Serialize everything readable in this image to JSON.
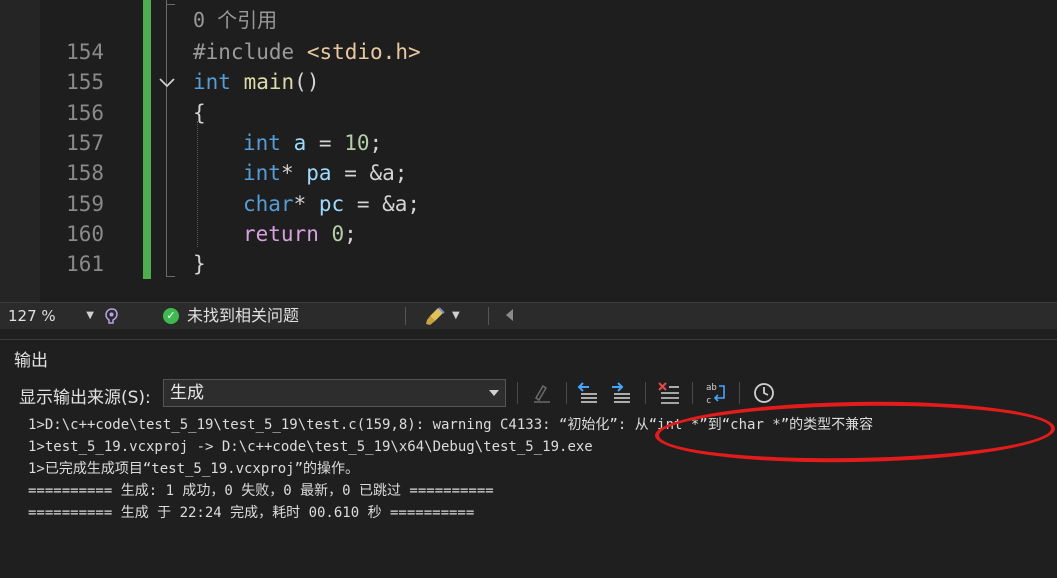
{
  "editor": {
    "codelens": "0 个引用",
    "lines": [
      {
        "num": "154"
      },
      {
        "num": "155"
      },
      {
        "num": "156"
      },
      {
        "num": "157"
      },
      {
        "num": "158"
      },
      {
        "num": "159"
      },
      {
        "num": "160"
      },
      {
        "num": "161"
      }
    ],
    "tokens": {
      "include_kw": "#include",
      "include_hdr": "<stdio.h>",
      "int": "int",
      "main": "main",
      "parens": "()",
      "brace_open": "{",
      "brace_close": "}",
      "a": "a",
      "eq": " = ",
      "ten": "10",
      "semi": ";",
      "int_ptr": "int",
      "star": "*",
      "pa": "pa",
      "amp_a": "&a",
      "char": "char",
      "pc": "pc",
      "return": "return",
      "zero": "0"
    }
  },
  "statusbar": {
    "zoom": "127 %",
    "issues": "未找到相关问题"
  },
  "output": {
    "title": "输出",
    "source_label": "显示输出来源(S):",
    "source_value": "生成",
    "lines": [
      "1>D:\\c++code\\test_5_19\\test_5_19\\test.c(159,8): warning C4133: “初始化”: 从“int *”到“char *”的类型不兼容",
      "1>test_5_19.vcxproj -> D:\\c++code\\test_5_19\\x64\\Debug\\test_5_19.exe",
      "1>已完成生成项目“test_5_19.vcxproj”的操作。",
      "========== 生成: 1 成功，0 失败，0 最新，0 已跳过 ==========",
      "========== 生成 于 22:24 完成，耗时 00.610 秒 =========="
    ]
  },
  "colors": {
    "change_bar": "#4cae4f",
    "annotation": "#e31b1b",
    "keyword": "#569cd6",
    "function": "#dcdcaa",
    "variable": "#9cdcfe",
    "number": "#b5cea8"
  }
}
